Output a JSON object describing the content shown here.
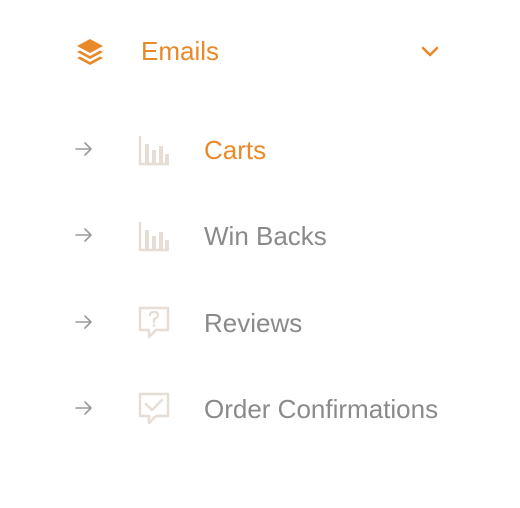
{
  "colors": {
    "accent": "#e8892a",
    "text": "#8a8a8a",
    "icon_muted": "#e6ddd4",
    "arrow": "#9a9a9a"
  },
  "menu": {
    "title": "Emails",
    "icon": "layers-icon",
    "expanded": true,
    "items": [
      {
        "label": "Carts",
        "icon": "bar-chart-icon",
        "active": true
      },
      {
        "label": "Win Backs",
        "icon": "bar-chart-icon",
        "active": false
      },
      {
        "label": "Reviews",
        "icon": "question-bubble-icon",
        "active": false
      },
      {
        "label": "Order Confirmations",
        "icon": "check-bubble-icon",
        "active": false
      }
    ]
  }
}
